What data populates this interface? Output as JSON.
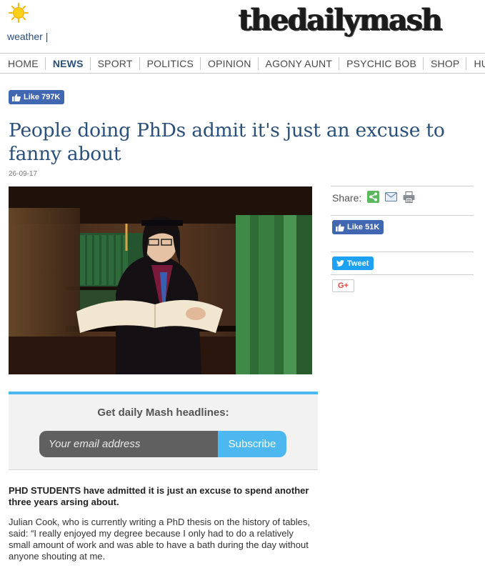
{
  "header": {
    "weather_link": "weather |",
    "logo_text": "thedailymash",
    "sun_icon": "sun-icon"
  },
  "nav": {
    "items": [
      {
        "label": "HOME",
        "active": false
      },
      {
        "label": "NEWS",
        "active": true
      },
      {
        "label": "SPORT",
        "active": false
      },
      {
        "label": "POLITICS",
        "active": false
      },
      {
        "label": "OPINION",
        "active": false
      },
      {
        "label": "AGONY AUNT",
        "active": false
      },
      {
        "label": "PSYCHIC BOB",
        "active": false
      },
      {
        "label": "SHOP",
        "active": false
      },
      {
        "label": "HUMP",
        "active": false
      }
    ]
  },
  "fb_like_top": {
    "label": "Like",
    "count": "797K"
  },
  "article": {
    "title": "People doing PhDs admit it's just an excuse to fanny about",
    "date": "26-09-17",
    "lead": "PHD STUDENTS have admitted it is just an excuse to spend another three years arsing about.",
    "body": "Julian Cook, who is currently writing a PhD thesis on the history of tables, said: “I really enjoyed my degree because I only had to do a relatively small amount of work and was able to have a bath during the day without anyone shouting at me."
  },
  "sidebar": {
    "share_label": "Share:",
    "share_icons": [
      "share-icon",
      "email-icon",
      "print-icon"
    ],
    "fb_like": {
      "label": "Like",
      "count": "51K"
    },
    "tweet_label": "Tweet",
    "gplus_label": "G+"
  },
  "newsletter": {
    "title": "Get daily Mash headlines:",
    "placeholder": "Your email address",
    "button": "Subscribe"
  },
  "colors": {
    "accent_blue": "#2a4f7a",
    "facebook": "#4267b2",
    "twitter": "#1da1f2",
    "subscribe": "#4db8ef"
  }
}
